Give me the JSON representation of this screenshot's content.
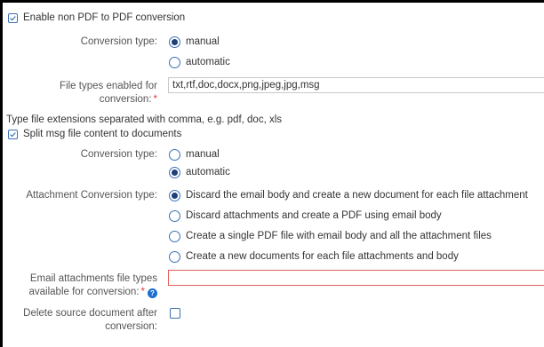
{
  "enable_conversion": {
    "label": "Enable non PDF to PDF conversion",
    "checked": true
  },
  "conversion_type": {
    "label": "Conversion type:",
    "options": [
      "manual",
      "automatic"
    ],
    "selected": "manual"
  },
  "file_types": {
    "label_line1": "File types enabled for",
    "label_line2": "conversion:",
    "required_mark": "*",
    "value": "txt,rtf,doc,docx,png,jpeg,jpg,msg"
  },
  "file_ext_hint": "Type file extensions separated with comma, e.g. pdf, doc, xls",
  "split_msg": {
    "label": "Split msg file content to documents",
    "checked": true
  },
  "msg_conversion_type": {
    "label": "Conversion type:",
    "options": [
      "manual",
      "automatic"
    ],
    "selected": "automatic"
  },
  "attachment_conversion": {
    "label": "Attachment Conversion type:",
    "options": [
      "Discard the email body and create a new document for each file attachment",
      "Discard attachments and create a PDF using email body",
      "Create a single PDF file with email body and all the attachment files",
      "Create a new documents for each file attachments and body"
    ],
    "selected_index": 0
  },
  "email_attachment_types": {
    "label_line1": "Email attachments file types",
    "label_line2": "available for conversion:",
    "required_mark": "*",
    "help_icon": "question-circle-icon",
    "help_glyph": "?",
    "value": ""
  },
  "delete_source": {
    "label_line1": "Delete source document after",
    "label_line2": "conversion:",
    "checked": false
  },
  "colors": {
    "accent": "#3a6fb5",
    "required": "#e03c3c",
    "error_border": "#e35d5d",
    "help": "#1c6ed1"
  }
}
